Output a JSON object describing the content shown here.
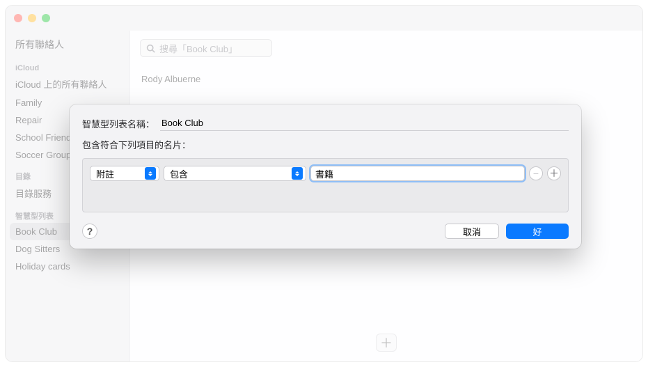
{
  "sidebar": {
    "top": "所有聯絡人",
    "icloud_head": "iCloud",
    "icloud_items": [
      "iCloud 上的所有聯絡人",
      "Family",
      "Repair",
      "School Friends",
      "Soccer Group"
    ],
    "dir_head": "目錄",
    "dir_items": [
      "目錄服務"
    ],
    "smart_head": "智慧型列表",
    "smart_items": [
      "Book Club",
      "Dog Sitters",
      "Holiday cards"
    ],
    "smart_selected_index": 0
  },
  "search": {
    "placeholder": "搜尋「Book Club」"
  },
  "contacts": [
    "Rody Albuerne"
  ],
  "sheet": {
    "name_label": "智慧型列表名稱：",
    "name_value": "Book Club",
    "contains_label": "包含符合下列項目的名片：",
    "rule": {
      "field": "附註",
      "operator": "包含",
      "value": "書籍"
    },
    "cancel": "取消",
    "ok": "好"
  }
}
